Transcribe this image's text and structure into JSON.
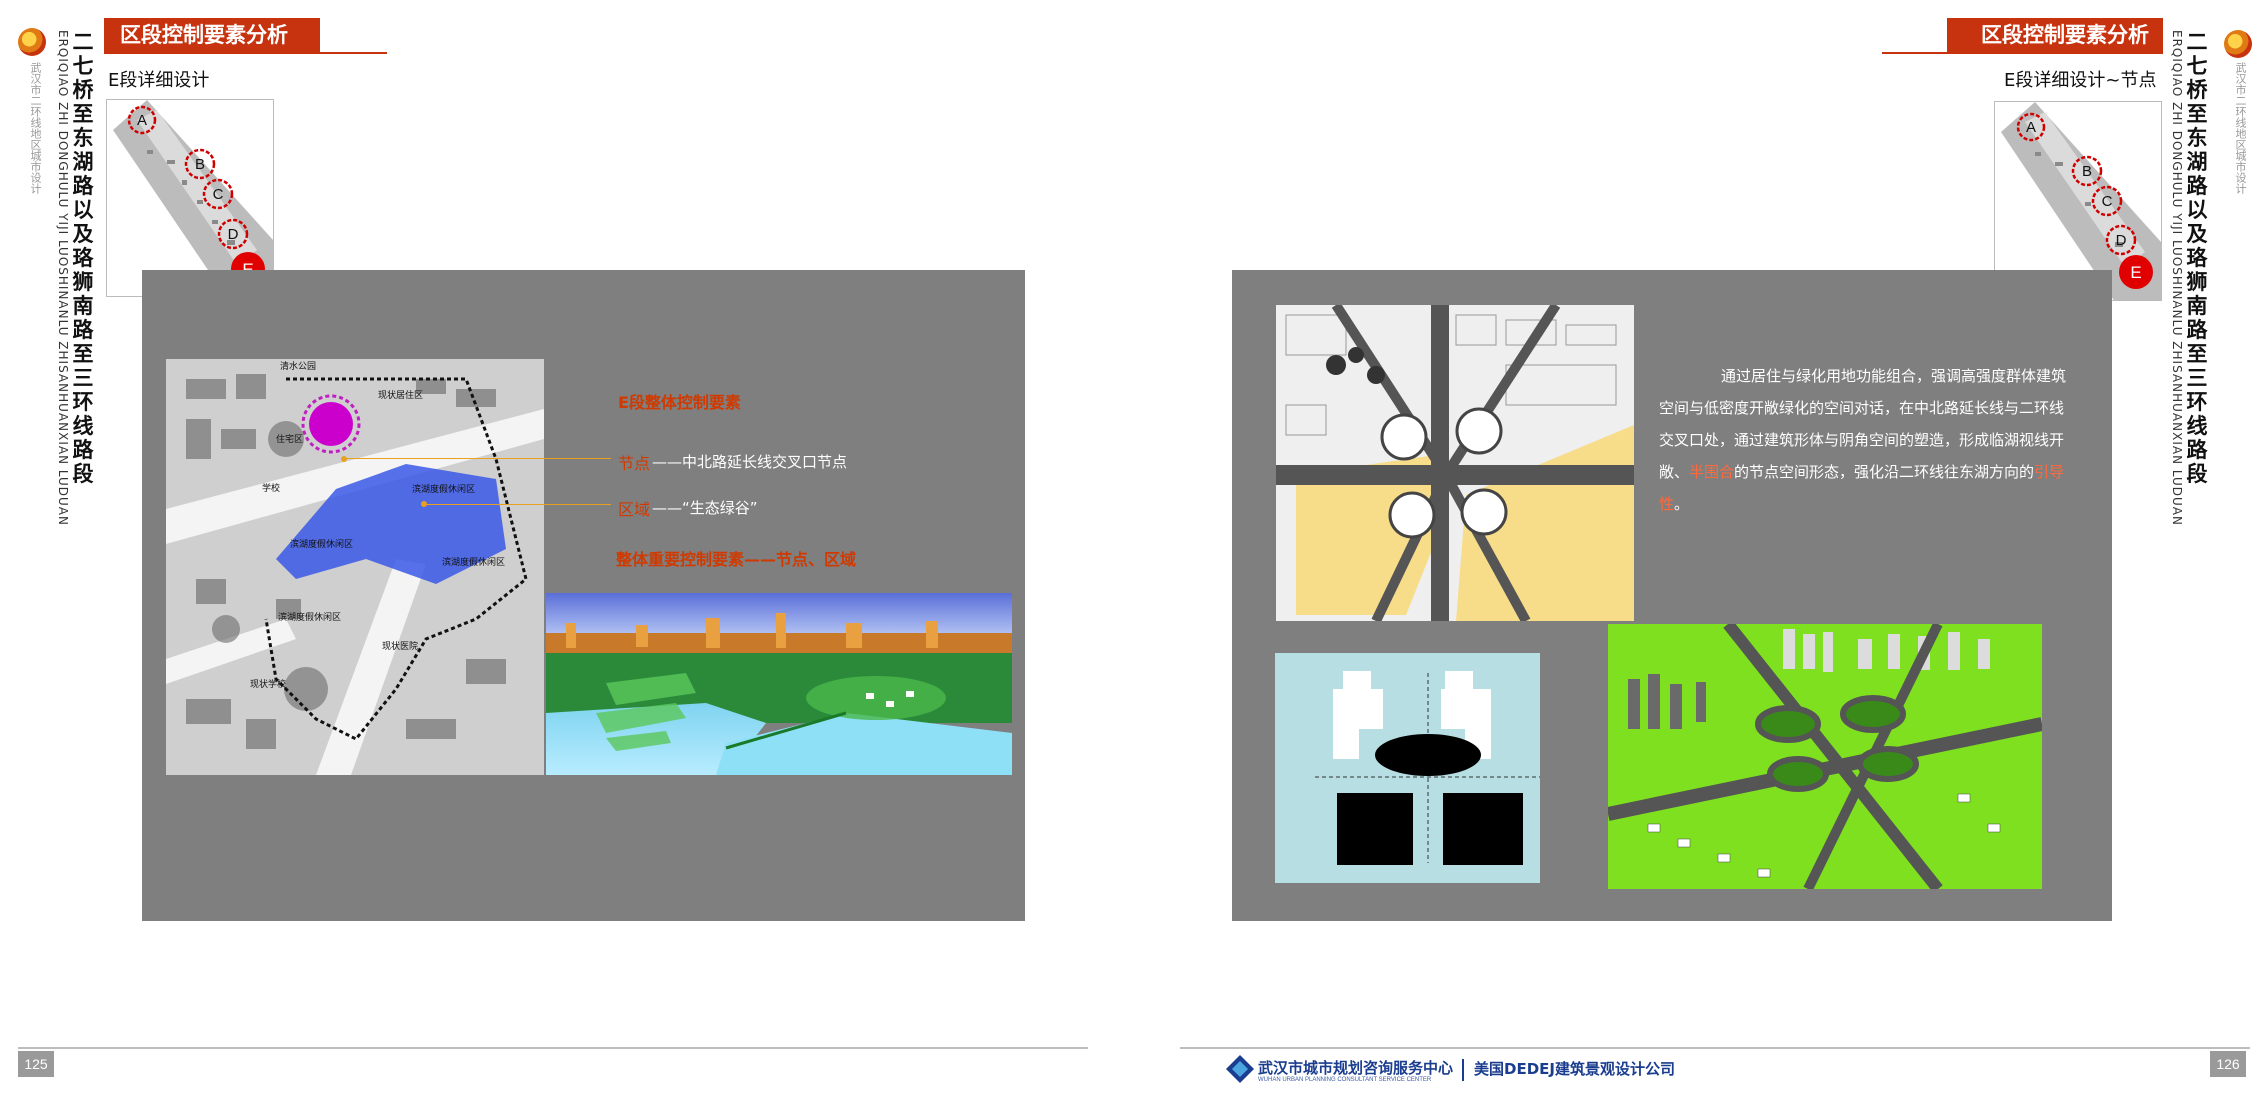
{
  "left_page": {
    "section_header": "区段控制要素分析",
    "subtitle": "E段详细设计",
    "page_number": "125",
    "map_labels": {
      "park": "清水公园",
      "existing_residential": "现状居住区",
      "residential": "住宅区",
      "school_short": "学校",
      "leisure_1": "滨湖度假休闲区",
      "leisure_2": "滨湖度假休闲区",
      "leisure_3": "滨湖度假休闲区",
      "hospital": "现状医院",
      "existing_school": "现状学校"
    },
    "annotations": {
      "heading": "E段整体控制要素",
      "node_label": "节点",
      "node_text": "——中北路延长线交叉口节点",
      "area_label": "区域",
      "area_text": "——“生态绿谷”",
      "summary": "整体重要控制要素——节点、区域"
    }
  },
  "right_page": {
    "section_header": "区段控制要素分析",
    "subtitle": "E段详细设计~节点",
    "page_number": "126",
    "paragraph": {
      "part1": "通过居住与绿化用地功能组合，强调高强度群体建筑空间与低密度开敞绿化的空间对话，在中北路延长线与二环线交叉口处，通过建筑形体与阴角空间的塑造，形成临湖视线开敞、",
      "hl1": "半围合",
      "part2": "的节点空间形态，强化沿二环线往东湖方向的",
      "hl2": "引导性",
      "part3": "。"
    }
  },
  "key_map": {
    "markers": [
      "A",
      "B",
      "C",
      "D",
      "E"
    ]
  },
  "vertical_title": {
    "chars": [
      "二",
      "七",
      "桥",
      "至",
      "东",
      "湖",
      "路",
      "以",
      "及",
      "珞",
      "狮",
      "南",
      "路",
      "至",
      "三",
      "环",
      "线",
      "路",
      "段"
    ],
    "pinyin": "ERQIQIAO ZHI DONGHULU YIJI LUOSHINANLU ZHISANHUANXIAN LUDUAN",
    "org_small": "武汉市二环线地区城市设计"
  },
  "footer": {
    "org_cn": "武汉市城市规划咨询服务中心",
    "org_en": "WUHAN URBAN PLANNING CONSULTANT SERVICE CENTER",
    "partner": "美国DEDEJ建筑景观设计公司"
  },
  "colors": {
    "accent_red": "#c8330f",
    "panel_grey": "#7f7f7f",
    "highlight_orange": "#ff6a3d",
    "footer_blue": "#1a3d8f"
  }
}
